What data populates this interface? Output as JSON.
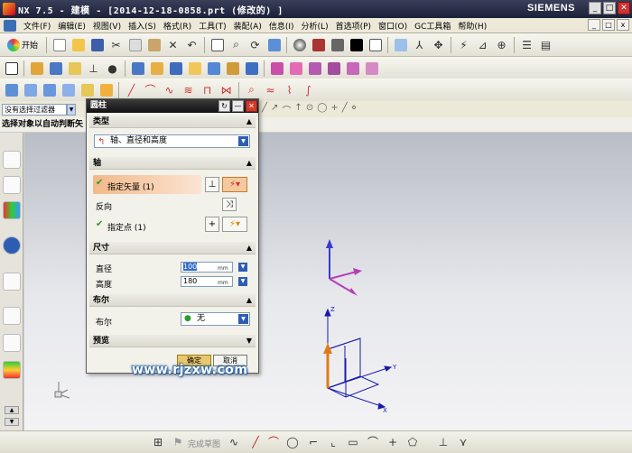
{
  "window": {
    "title": "NX 7.5 - 建模 - [2014-12-18-0858.prt  (修改的) ]",
    "brand": "SIEMENS",
    "min_label": "_",
    "max_label": "□",
    "close_label": "✕"
  },
  "menubar": {
    "items": [
      "文件(F)",
      "编辑(E)",
      "视图(V)",
      "插入(S)",
      "格式(R)",
      "工具(T)",
      "装配(A)",
      "信息(I)",
      "分析(L)",
      "首选项(P)",
      "窗口(O)",
      "GC工具箱",
      "帮助(H)"
    ]
  },
  "toolbar": {
    "start_label": "开始"
  },
  "filterbar": {
    "filter_value": "没有选择过滤器",
    "drop_label": "▼"
  },
  "infobar": {
    "text": "选择对象以自动判断矢"
  },
  "dialog": {
    "title": "圆柱",
    "reset_label": "↻",
    "min_label": "—",
    "close_label": "✕",
    "type_section": "类型",
    "type_value": "轴、直径和高度",
    "axis_section": "轴",
    "specify_vector": "指定矢量 (1)",
    "reverse_label": "反向",
    "specify_point": "指定点 (1)",
    "size_section": "尺寸",
    "diameter_label": "直径",
    "diameter_value": "100",
    "height_label": "高度",
    "height_value": "180",
    "unit": "mm",
    "boolean_section": "布尔",
    "boolean_label": "布尔",
    "boolean_value": "无",
    "preview_section": "预览",
    "ok_label": "确定",
    "cancel_label": "取消",
    "collapse_up": "▲",
    "collapse_down": "▼"
  },
  "bottombar": {
    "sketch_label": "完成草图"
  },
  "viewport": {
    "axis_x": "X",
    "axis_y": "Y",
    "axis_z": "Z"
  },
  "watermark": "www.rjzxw.com",
  "colors": {
    "titlebar": "#1c2038",
    "dialog_title": "#121212",
    "vector_highlight": "#f2b98a",
    "datum_x": "#1a1aa8",
    "datum_y": "#1a1aa8",
    "datum_z": "#1a1aa8",
    "vector_arrow": "#e07b1a",
    "triad_x": "#b53fb5",
    "triad_z": "#3a3ad0"
  }
}
